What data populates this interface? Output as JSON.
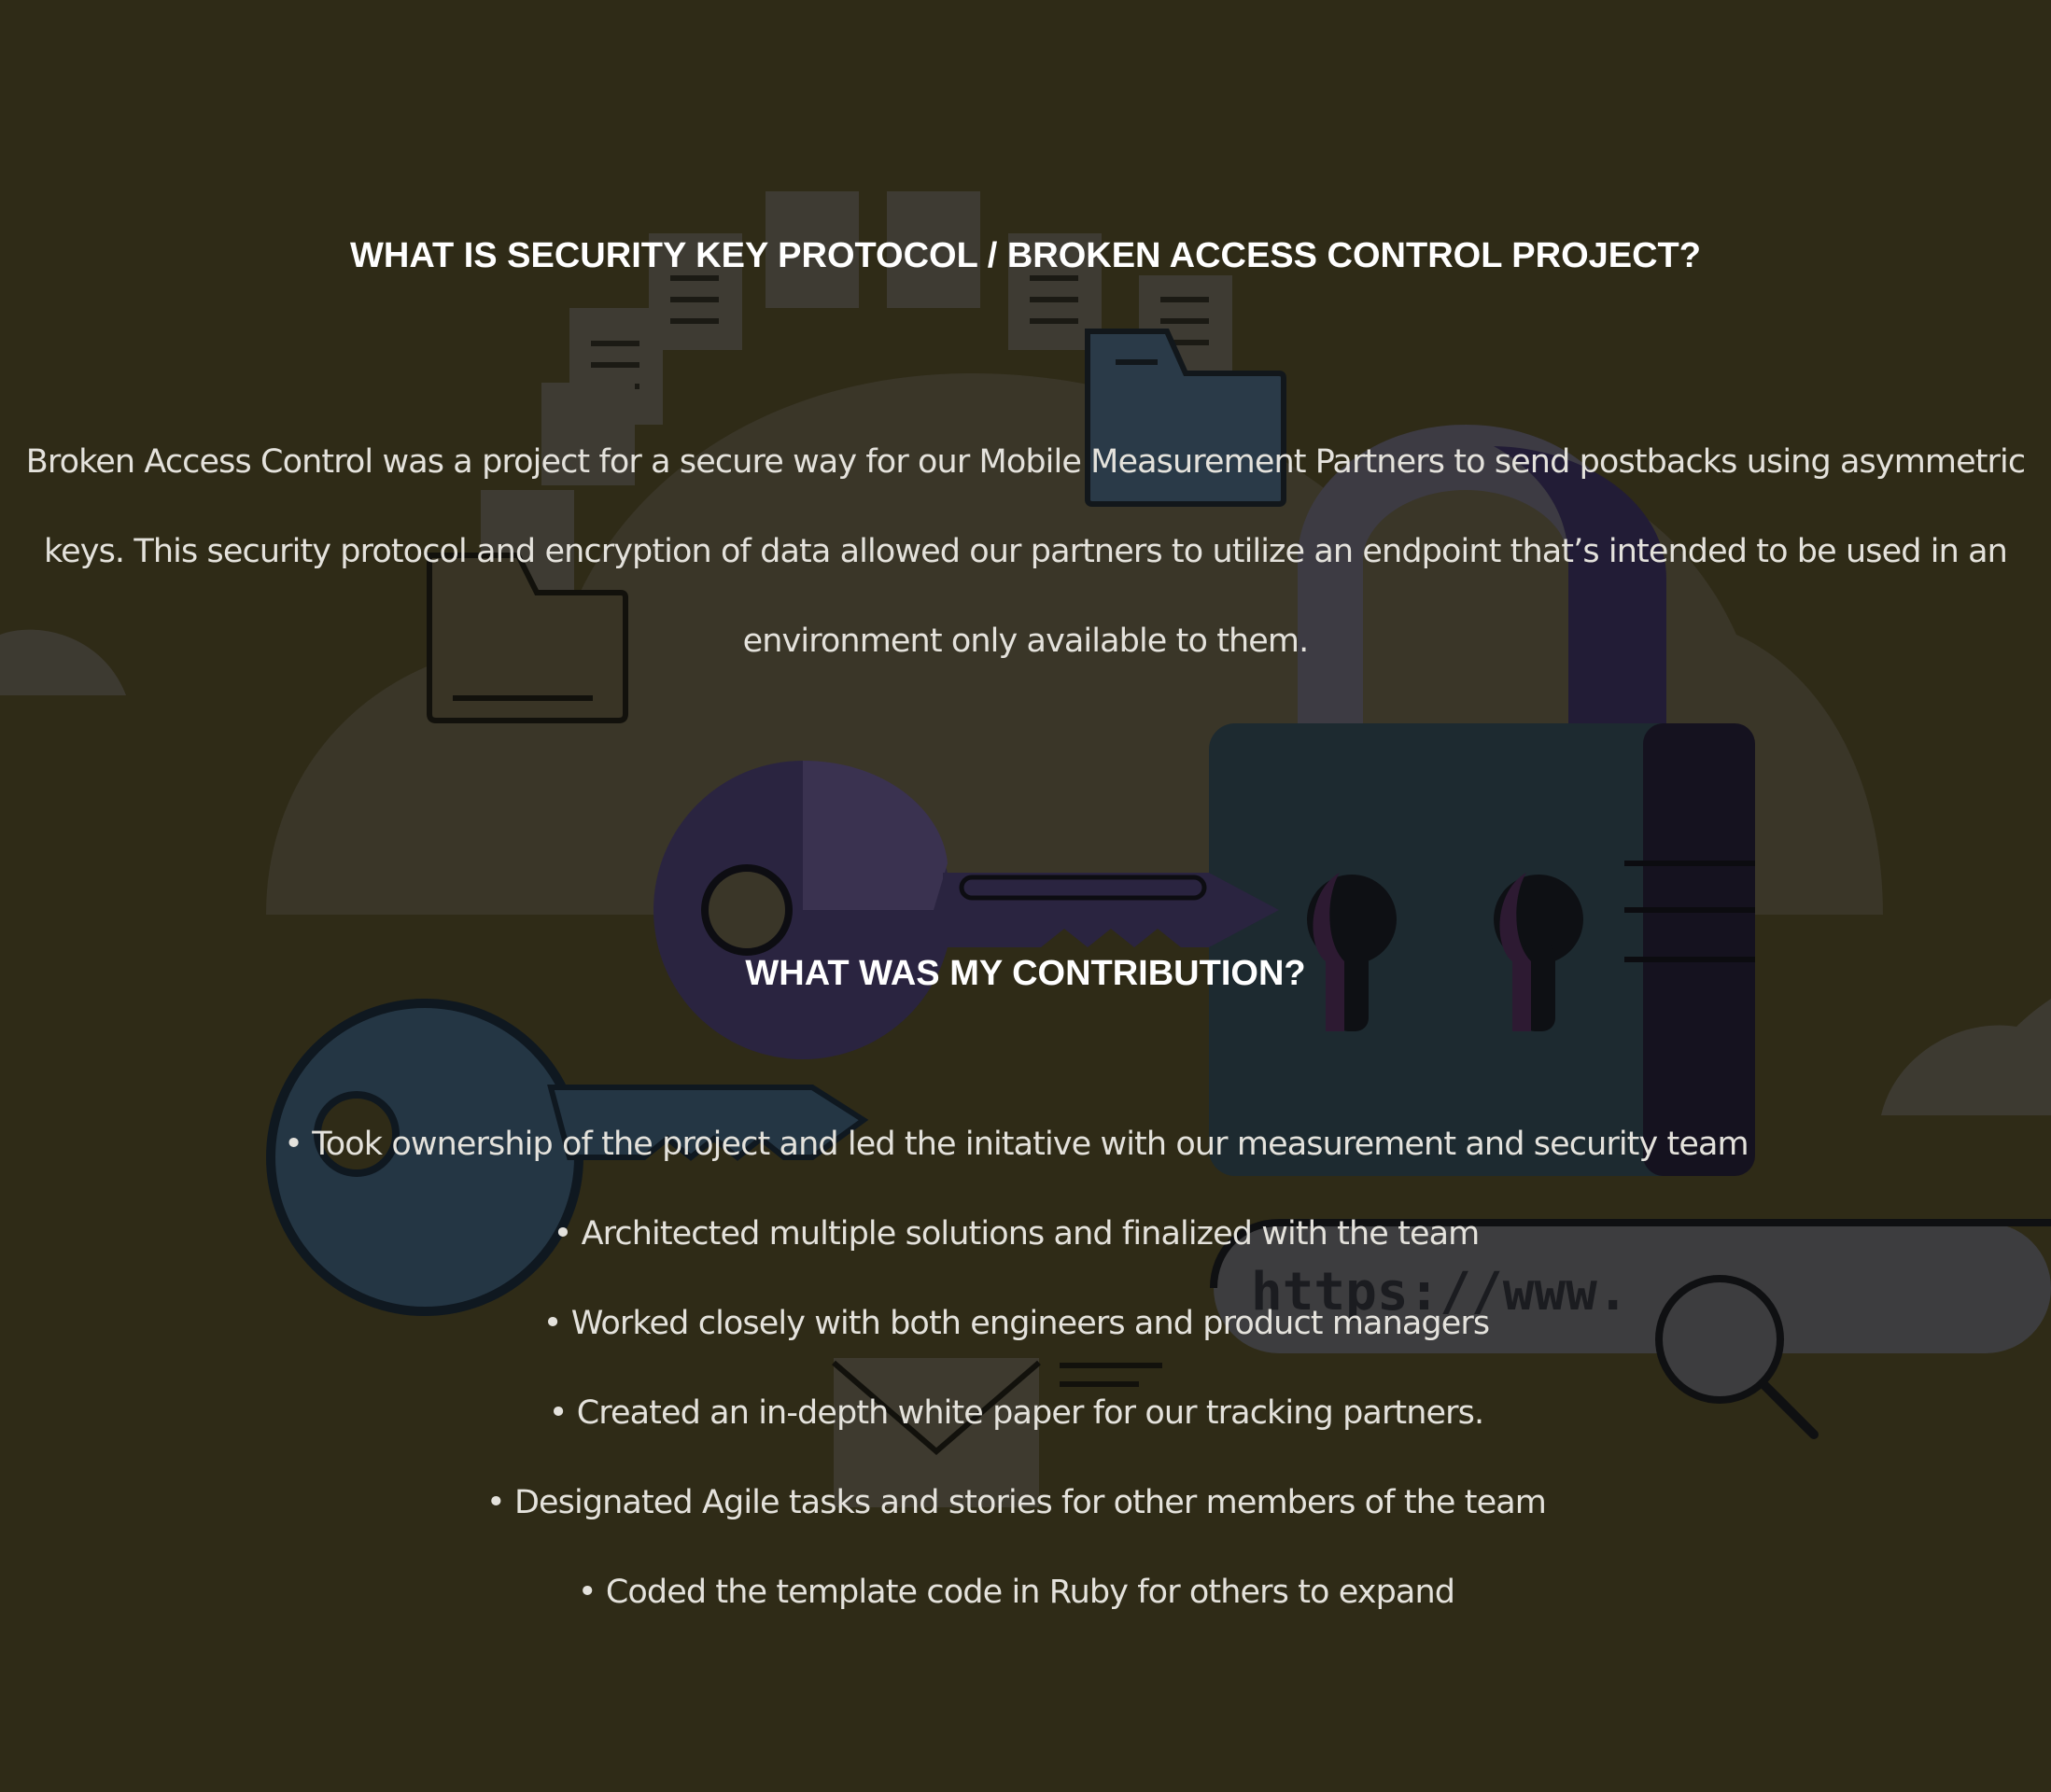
{
  "sections": {
    "project_title": "WHAT IS SECURITY KEY PROTOCOL / BROKEN ACCESS CONTROL PROJECT?",
    "project_description": "Broken Access Control was a project for a secure way for our Mobile Measurement Partners to send postbacks using asymmetric keys. This security protocol and encryption of data allowed our partners to utilize an endpoint that’s intended to be used in an environment only available to them.",
    "contribution_title": "WHAT WAS MY CONTRIBUTION?",
    "contributions": [
      "• Took ownership of the project and led the initative with our measurement and security team",
      "• Architected multiple solutions and finalized with the team",
      "• Worked closely with both engineers and product managers",
      "• Created an in-depth white paper for our tracking partners.",
      "• Designated Agile tasks and stories for other members of the team",
      "• Coded the template code in Ruby for others to expand"
    ]
  },
  "illustration": {
    "url_bar_text": "https://www.",
    "icons": [
      "cloud-icon",
      "padlock-icon",
      "key-icon",
      "document-icon",
      "folder-icon",
      "search-icon",
      "envelope-icon"
    ]
  },
  "colors": {
    "background": "#2f2b17",
    "overlay_text": "#ffffff",
    "body_text": "#e4e2dc",
    "padlock_body": "#1d2a30",
    "key_dark": "#2a2440",
    "key_blue": "#243644",
    "cloud": "#3a3628"
  }
}
